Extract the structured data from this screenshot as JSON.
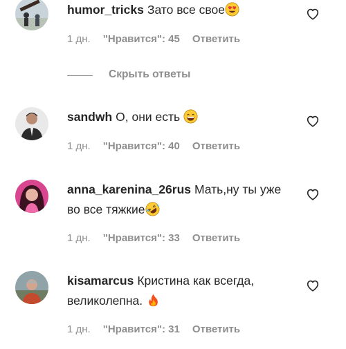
{
  "comments": [
    {
      "username": "humor_tricks",
      "text": "Зато все свое",
      "emoji": "heart-eyes-emoji",
      "time": "1 дн.",
      "likes": "\"Нравится\": 45",
      "reply": "Ответить"
    },
    {
      "username": "sandwh",
      "text": "О, они есть",
      "emoji": "grinning-face-emoji",
      "time": "1 дн.",
      "likes": "\"Нравится\": 40",
      "reply": "Ответить"
    },
    {
      "username": "anna_karenina_26rus",
      "text": "Мать,ну ты уже во все тяжкие",
      "emoji": "rolling-laughing-emoji",
      "time": "1 дн.",
      "likes": "\"Нравится\": 33",
      "reply": "Ответить"
    },
    {
      "username": "kisamarcus",
      "text": "Кристина как всегда, великолепна.",
      "emoji": "fire-emoji",
      "time": "1 дн.",
      "likes": "\"Нравится\": 31",
      "reply": "Ответить"
    }
  ],
  "hide_replies_label": "Скрыть ответы",
  "colors": {
    "text": "#262626",
    "secondary": "#8e8e8e",
    "background": "#ffffff"
  }
}
